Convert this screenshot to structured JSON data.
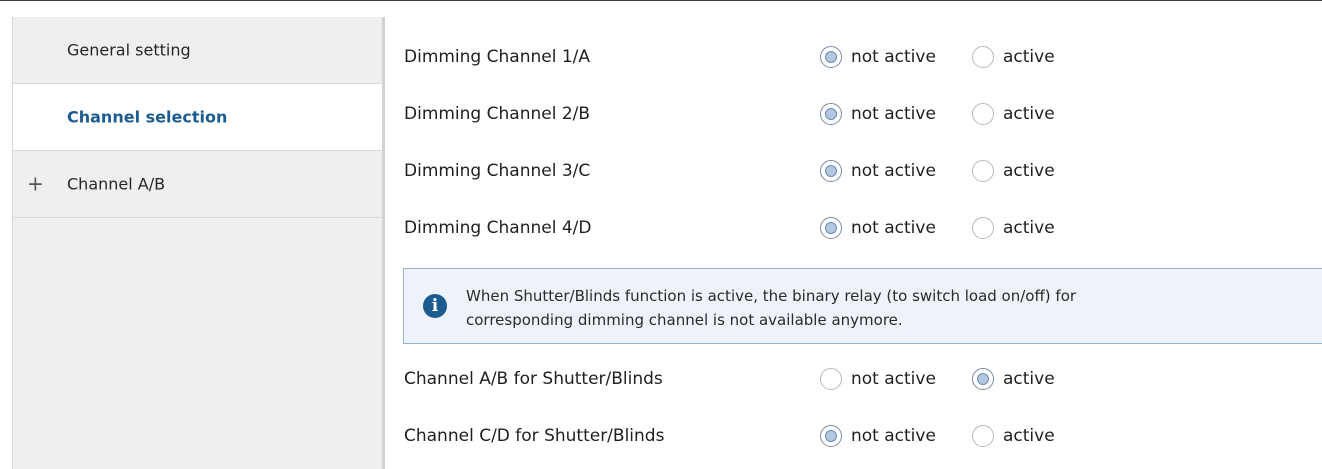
{
  "sidebar": {
    "items": [
      {
        "label": "General setting",
        "selected": false,
        "expandable": false
      },
      {
        "label": "Channel selection",
        "selected": true,
        "expandable": false
      },
      {
        "label": "Channel A/B",
        "selected": false,
        "expandable": true,
        "expand_glyph": "+"
      }
    ]
  },
  "params": [
    {
      "label": "Dimming Channel 1/A",
      "options": [
        "not active",
        "active"
      ],
      "selected": "not active"
    },
    {
      "label": "Dimming Channel 2/B",
      "options": [
        "not active",
        "active"
      ],
      "selected": "not active"
    },
    {
      "label": "Dimming Channel 3/C",
      "options": [
        "not active",
        "active"
      ],
      "selected": "not active"
    },
    {
      "label": "Dimming Channel 4/D",
      "options": [
        "not active",
        "active"
      ],
      "selected": "not active"
    },
    {
      "label": "Channel A/B for Shutter/Blinds",
      "options": [
        "not active",
        "active"
      ],
      "selected": "active"
    },
    {
      "label": "Channel C/D for Shutter/Blinds",
      "options": [
        "not active",
        "active"
      ],
      "selected": "not active"
    }
  ],
  "info": {
    "icon": "info-icon",
    "glyph": "i",
    "text_line1": "When Shutter/Blinds function is active, the binary relay (to switch load on/off) for",
    "text_line2": "corresponding dimming channel is not available anymore."
  },
  "colors": {
    "accent": "#1c5b8f",
    "sidebar_bg": "#efefef",
    "info_bg": "#eef3f9",
    "info_border": "#9bb3cf"
  }
}
